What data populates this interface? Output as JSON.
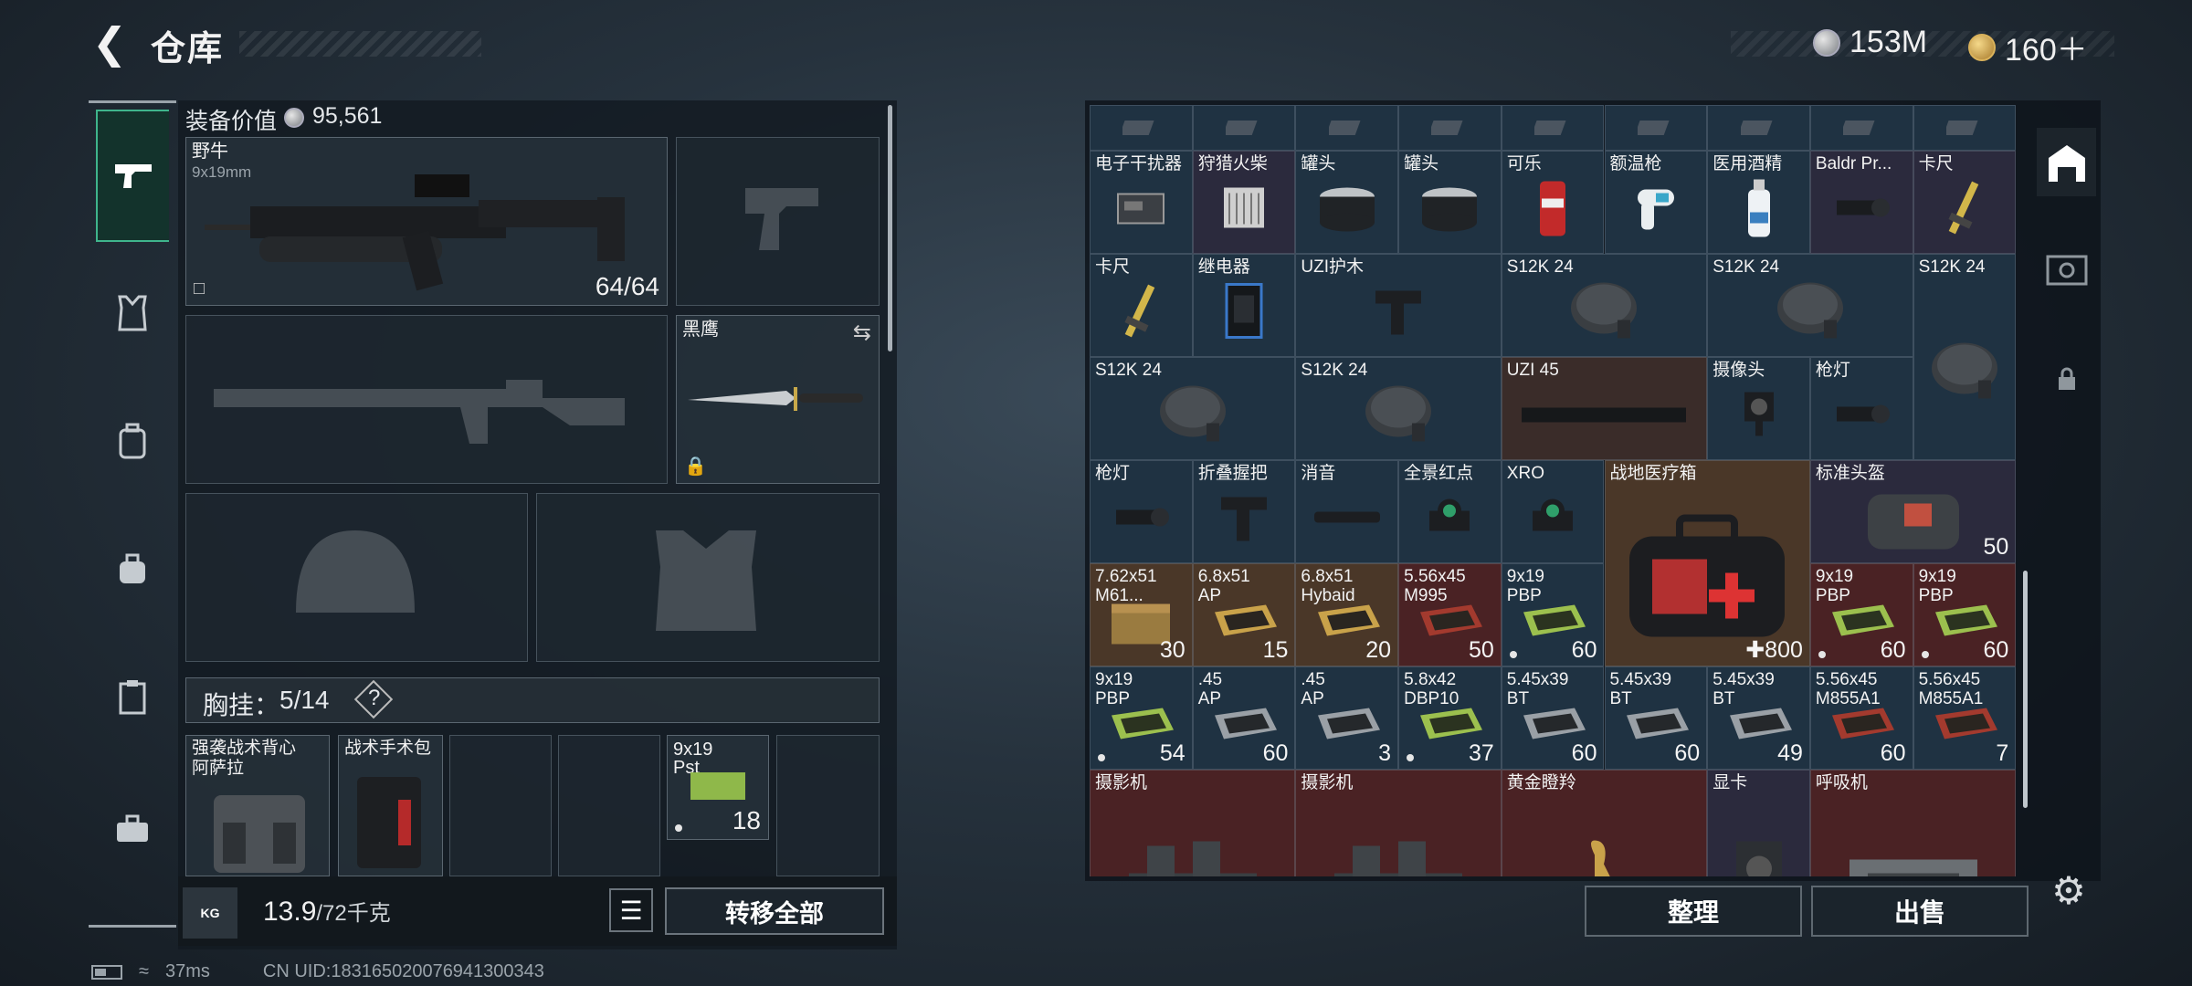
{
  "header": {
    "title": "仓库",
    "back_icon": "back-arrow-icon",
    "currency": [
      {
        "icon": "silver-coin-icon",
        "value": "153M"
      },
      {
        "icon": "gold-coin-icon",
        "value": "160＋"
      }
    ]
  },
  "sidebar": {
    "items": [
      {
        "icon": "pistol-icon",
        "active": true
      },
      {
        "icon": "armor-vest-icon"
      },
      {
        "icon": "backpack-icon"
      },
      {
        "icon": "bag-icon"
      },
      {
        "icon": "clipboard-icon"
      },
      {
        "icon": "toolbox-icon"
      }
    ]
  },
  "loadout": {
    "value_label": "装备价值",
    "value": "95,561",
    "primary": {
      "name": "野牛",
      "ammo": "9x19mm",
      "count": "64/64"
    },
    "melee": {
      "name": "黑鹰"
    },
    "rig": {
      "label": "胸挂：",
      "count": "5/14",
      "help": "?"
    },
    "rig_items": [
      {
        "name": "强袭战术背心",
        "sub": "阿萨拉"
      },
      {
        "name": "战术手术包"
      },
      {
        "name": "9x19",
        "sub": "Pst",
        "count": "18"
      }
    ]
  },
  "bottom": {
    "weight": "13.9",
    "weight_max": "/72千克",
    "kg": "KG",
    "transfer_all": "转移全部"
  },
  "status": {
    "ping": "37ms",
    "uid": "CN UID:1831650200769413003​43"
  },
  "stash": {
    "cells": [
      {
        "n": "电子干扰器",
        "c": "c-blue",
        "ic": "device"
      },
      {
        "n": "狩猎火柴",
        "c": "c-purple",
        "ic": "box"
      },
      {
        "n": "罐头",
        "c": "c-blue",
        "ic": "can"
      },
      {
        "n": "罐头",
        "c": "c-blue",
        "ic": "can"
      },
      {
        "n": "可乐",
        "c": "c-blue",
        "ic": "cola"
      },
      {
        "n": "额温枪",
        "c": "c-blue",
        "ic": "thermo"
      },
      {
        "n": "医用酒精",
        "c": "c-blue",
        "ic": "bottle"
      },
      {
        "n": "Baldr Pr...",
        "c": "c-purple",
        "ic": "light"
      },
      {
        "n": "卡尺",
        "c": "c-purple",
        "ic": "caliper"
      },
      {
        "n": "卡尺",
        "c": "c-blue",
        "ic": "caliper"
      },
      {
        "n": "继电器",
        "c": "c-blue",
        "ic": "relay"
      },
      {
        "n": "UZI护木",
        "c": "c-blue",
        "ic": "grip"
      },
      {
        "n": "S12K 24",
        "c": "c-blue",
        "ic": "drum"
      },
      {
        "n": "S12K 24",
        "c": "c-blue",
        "ic": "drum"
      },
      {
        "n": "S12K 24",
        "c": "c-blue",
        "ic": "drum"
      },
      {
        "n": "S12K 24",
        "c": "c-blue",
        "ic": "drum"
      },
      {
        "n": "S12K 24",
        "c": "c-blue",
        "ic": "drum"
      },
      {
        "n": "UZI 45",
        "c": "c-ex",
        "ic": "mag"
      },
      {
        "n": "摄像头",
        "c": "c-blue",
        "ic": "cam"
      },
      {
        "n": "枪灯",
        "c": "c-blue",
        "ic": "light"
      },
      {
        "n": "枪灯",
        "c": "c-blue",
        "ic": "light"
      },
      {
        "n": "折叠握把",
        "c": "c-blue",
        "ic": "grip"
      },
      {
        "n": "消音",
        "c": "c-blue",
        "ic": "supp"
      },
      {
        "n": "全景红点",
        "c": "c-blue",
        "ic": "sight"
      },
      {
        "n": "XRO",
        "c": "c-blue",
        "ic": "sight"
      },
      {
        "n": "战地医疗箱",
        "c": "c-gold",
        "ic": "medkit",
        "count": "800"
      },
      {
        "n": "标准头盔",
        "c": "c-purple",
        "ic": "helmetbag",
        "count": "50"
      },
      {
        "n": "7.62x51",
        "s": "M61...",
        "c": "c-gold",
        "ic": "ammobox",
        "count": "30"
      },
      {
        "n": "6.8x51",
        "s": "AP",
        "c": "c-gold",
        "ic": "ammo-gold",
        "count": "15"
      },
      {
        "n": "6.8x51",
        "s": "Hybaid",
        "c": "c-gold",
        "ic": "ammo-gold",
        "count": "20"
      },
      {
        "n": "5.56x45",
        "s": "M995",
        "c": "c-red",
        "ic": "ammo-red",
        "count": "50"
      },
      {
        "n": "9x19",
        "s": "PBP",
        "c": "c-blue",
        "ic": "ammo-green",
        "count": "60"
      },
      {
        "n": "9x19",
        "s": "PBP",
        "c": "c-red",
        "ic": "ammo-green",
        "count": "60"
      },
      {
        "n": "9x19",
        "s": "PBP",
        "c": "c-red",
        "ic": "ammo-green",
        "count": "60"
      },
      {
        "n": "9x19",
        "s": "PBP",
        "c": "c-blue",
        "ic": "ammo-green",
        "count": "54"
      },
      {
        "n": ".45",
        "s": "AP",
        "c": "c-blue",
        "ic": "ammo-gray",
        "count": "60"
      },
      {
        "n": ".45",
        "s": "AP",
        "c": "c-blue",
        "ic": "ammo-gray",
        "count": "3"
      },
      {
        "n": "5.8x42",
        "s": "DBP10",
        "c": "c-blue",
        "ic": "ammo-green",
        "count": "37"
      },
      {
        "n": "5.45x39",
        "s": "BT",
        "c": "c-blue",
        "ic": "ammo-gray",
        "count": "60"
      },
      {
        "n": "5.45x39",
        "s": "BT",
        "c": "c-blue",
        "ic": "ammo-gray",
        "count": "60"
      },
      {
        "n": "5.45x39",
        "s": "BT",
        "c": "c-blue",
        "ic": "ammo-gray",
        "count": "49"
      },
      {
        "n": "5.56x45",
        "s": "M855A1",
        "c": "c-blue",
        "ic": "ammo-red",
        "count": "60"
      },
      {
        "n": "5.56x45",
        "s": "M855A1",
        "c": "c-blue",
        "ic": "ammo-red",
        "count": "7"
      },
      {
        "n": "摄影机",
        "c": "c-red",
        "ic": "camera"
      },
      {
        "n": "摄影机",
        "c": "c-red",
        "ic": "camera"
      },
      {
        "n": "黄金瞪羚",
        "c": "c-red",
        "ic": "gazelle"
      },
      {
        "n": "显卡",
        "c": "c-purple",
        "ic": "gpu"
      },
      {
        "n": "呼吸机",
        "c": "c-red",
        "ic": "vent"
      }
    ]
  },
  "actions": {
    "sort": "整理",
    "sell": "出售"
  }
}
